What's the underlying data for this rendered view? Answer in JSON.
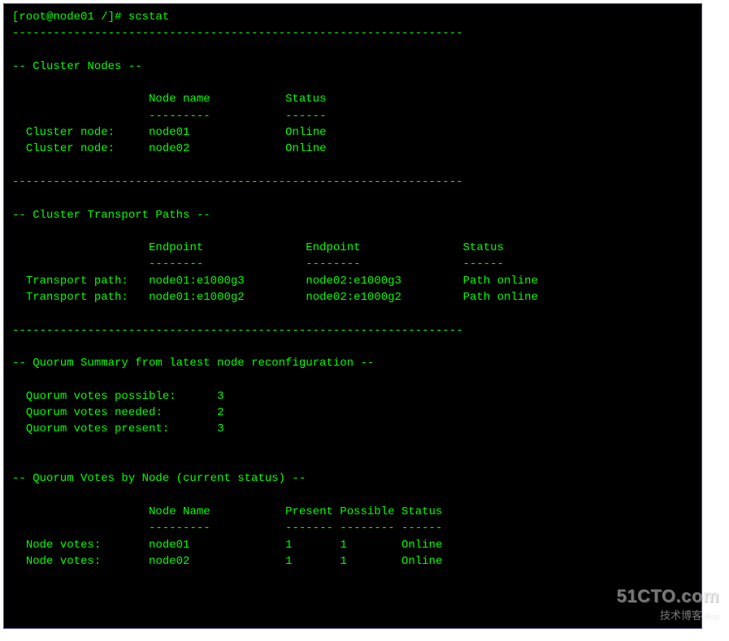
{
  "prompt": {
    "user_host": "[root@node01 /]#",
    "command": "scstat"
  },
  "divider": "------------------------------------------------------------------",
  "sections": {
    "cluster_nodes": {
      "header": "-- Cluster Nodes --",
      "columns": {
        "c1": "Node name",
        "c2": "Status"
      },
      "underline": {
        "u1": "---------",
        "u2": "------"
      },
      "row_label": "Cluster node:",
      "rows": [
        {
          "name": "node01",
          "status": "Online"
        },
        {
          "name": "node02",
          "status": "Online"
        }
      ]
    },
    "transport_paths": {
      "header": "-- Cluster Transport Paths --",
      "columns": {
        "c1": "Endpoint",
        "c2": "Endpoint",
        "c3": "Status"
      },
      "underline": {
        "u1": "--------",
        "u2": "--------",
        "u3": "------"
      },
      "row_label": "Transport path:",
      "rows": [
        {
          "ep1": "node01:e1000g3",
          "ep2": "node02:e1000g3",
          "status": "Path online"
        },
        {
          "ep1": "node01:e1000g2",
          "ep2": "node02:e1000g2",
          "status": "Path online"
        }
      ]
    },
    "quorum_summary": {
      "header": "-- Quorum Summary from latest node reconfiguration --",
      "rows": [
        {
          "label": "Quorum votes possible:",
          "value": "3"
        },
        {
          "label": "Quorum votes needed:",
          "value": "2"
        },
        {
          "label": "Quorum votes present:",
          "value": "3"
        }
      ]
    },
    "quorum_votes": {
      "header": "-- Quorum Votes by Node (current status) --",
      "columns": {
        "c1": "Node Name",
        "c2": "Present",
        "c3": "Possible",
        "c4": "Status"
      },
      "underline": {
        "u1": "---------",
        "u2": "-------",
        "u3": "--------",
        "u4": "------"
      },
      "row_label": "Node votes:",
      "rows": [
        {
          "name": "node01",
          "present": "1",
          "possible": "1",
          "status": "Online"
        },
        {
          "name": "node02",
          "present": "1",
          "possible": "1",
          "status": "Online"
        }
      ]
    }
  },
  "watermark": {
    "top": "51CTO.com",
    "bottom_cn": "技术博客",
    "bottom_en": "Blog"
  }
}
